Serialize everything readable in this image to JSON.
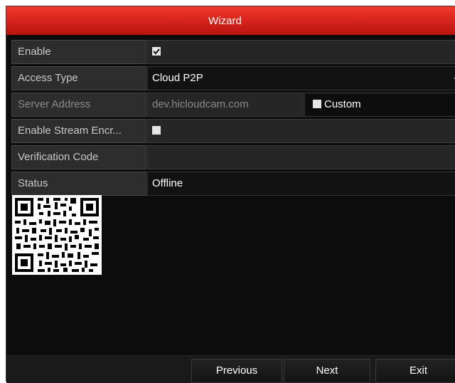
{
  "window": {
    "title": "Wizard"
  },
  "form": {
    "enable": {
      "label": "Enable",
      "checked": true
    },
    "access_type": {
      "label": "Access Type",
      "value": "Cloud P2P"
    },
    "server_address": {
      "label": "Server Address",
      "value": "dev.hicloudcam.com",
      "custom_label": "Custom",
      "custom_checked": false
    },
    "stream_encryption": {
      "label": "Enable Stream Encr...",
      "checked": false
    },
    "verification_code": {
      "label": "Verification Code",
      "value": ""
    },
    "status": {
      "label": "Status",
      "value": "Offline"
    }
  },
  "buttons": {
    "previous": "Previous",
    "next": "Next",
    "exit": "Exit"
  },
  "colors": {
    "title_bar": "#d8251d",
    "background": "#0c0c0c",
    "label_bg": "#2d2d2d"
  }
}
